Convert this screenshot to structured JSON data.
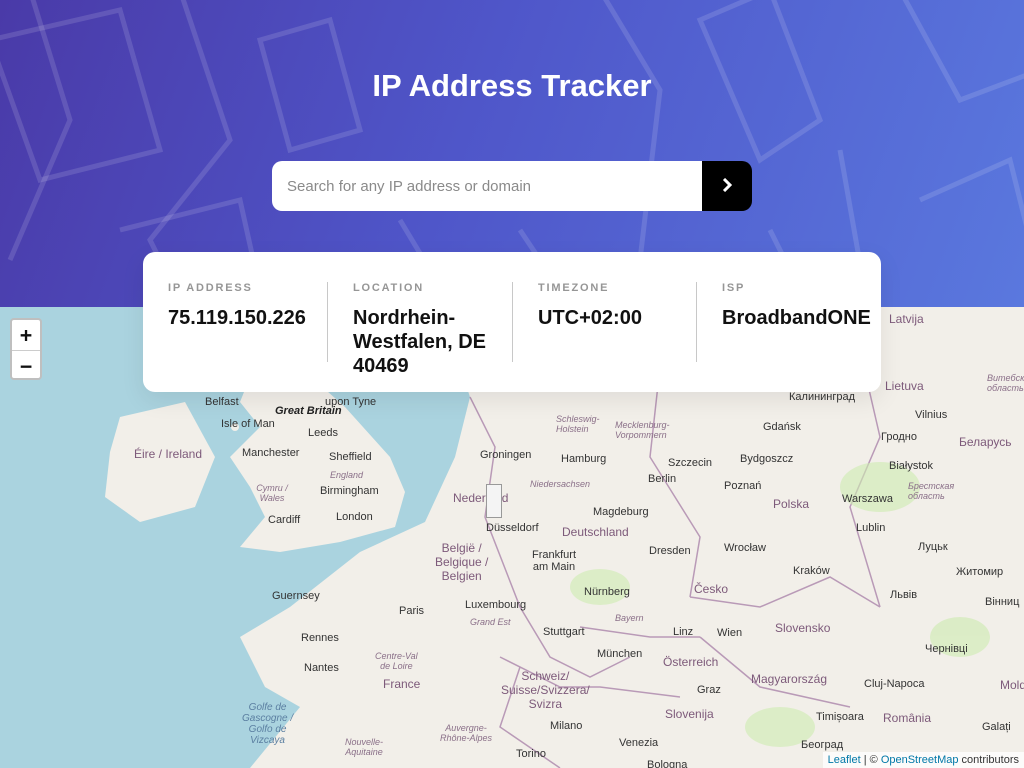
{
  "header": {
    "title": "IP Address Tracker",
    "search_placeholder": "Search for any IP address or domain",
    "search_value": "",
    "submit_icon": "chevron-right-icon"
  },
  "info": {
    "ip_label": "IP ADDRESS",
    "ip_value": "75.119.150.226",
    "location_label": "LOCATION",
    "location_value": "Nordrhein-Westfalen, DE 40469",
    "timezone_label": "TIMEZONE",
    "timezone_value": "UTC+02:00",
    "isp_label": "ISP",
    "isp_value": "BroadbandONE"
  },
  "map": {
    "zoom_in": "+",
    "zoom_out": "−",
    "attribution_leaflet": "Leaflet",
    "attribution_sep": " | © ",
    "attribution_osm": "OpenStreetMap",
    "attribution_suffix": " contributors",
    "labels": {
      "belfast": "Belfast",
      "great_britain": "Great Britain",
      "upon_tyne": "upon Tyne",
      "isle_of_man": "Isle of Man",
      "leeds": "Leeds",
      "eire": "Éire / Ireland",
      "manchester": "Manchester",
      "sheffield": "Sheffield",
      "england": "England",
      "cymru": "Cymru /\nWales",
      "birmingham": "Birmingham",
      "cardiff": "Cardiff",
      "london": "London",
      "groningen": "Groningen",
      "nederland": "Nederland",
      "hamburg": "Hamburg",
      "schleswig": "Schleswig-\nHolstein",
      "mecklenburg": "Mecklenburg-\nVorpommern",
      "niedersachsen": "Niedersachsen",
      "dusseldorf": "Düsseldorf",
      "deutschland": "Deutschland",
      "magdeburg": "Magdeburg",
      "berlin": "Berlin",
      "szczecin": "Szczecin",
      "gdansk": "Gdańsk",
      "bydgoszcz": "Bydgoszcz",
      "poznan": "Poznań",
      "kaliningrad": "Калининград",
      "latvija": "Latvija",
      "lietuva": "Lietuva",
      "vilnius": "Vilnius",
      "grodno": "Гродно",
      "belarus": "Беларусь",
      "vitebsk": "Витебская\nобласть",
      "bialystok": "Białystok",
      "brest": "Брестская\nобласть",
      "warszawa": "Warszawa",
      "polska": "Polska",
      "lublin": "Lublin",
      "lutsk": "Луцьк",
      "zhytomyr": "Житомир",
      "belgie": "België /\nBelgique /\nBelgien",
      "frankfurt": "Frankfurt\nam Main",
      "dresden": "Dresden",
      "wroclaw": "Wrocław",
      "krakow": "Kraków",
      "lviv": "Львів",
      "vinnytsia": "Вінниц",
      "guernsey": "Guernsey",
      "luxembourg": "Luxembourg",
      "cesko": "Česko",
      "paris": "Paris",
      "grand_est": "Grand Est",
      "nurnberg": "Nürnberg",
      "bayern": "Bayern",
      "stuttgart": "Stuttgart",
      "linz": "Linz",
      "wien": "Wien",
      "slovensko": "Slovensko",
      "rennes": "Rennes",
      "nantes": "Nantes",
      "centre_val": "Centre-Val\nde Loire",
      "france": "France",
      "munchen": "München",
      "osterreich": "Österreich",
      "chernivtsi": "Чернівці",
      "magyarorszag": "Magyarország",
      "schweiz": "Schweiz/\nSuisse/Svizzera/\nSvizra",
      "graz": "Graz",
      "cluj": "Cluj-Napoca",
      "moldova": "Moldo",
      "golfe": "Golfe de\nGascogne /\nGolfo de\nVizcaya",
      "slovenija": "Slovenija",
      "timisoara": "Timișoara",
      "romania": "România",
      "galati": "Galați",
      "milano": "Milano",
      "auvergne": "Auvergne-\nRhône-Alpes",
      "nouvelle": "Nouvelle-\nAquitaine",
      "torino": "Torino",
      "venezia": "Venezia",
      "bologna": "Bologna",
      "beograd": "Београд"
    }
  },
  "colors": {
    "header_gradient_start": "#4a3aa8",
    "header_gradient_end": "#5a78de",
    "sea": "#aad3df",
    "land": "#f2efe9",
    "button": "#000000"
  }
}
